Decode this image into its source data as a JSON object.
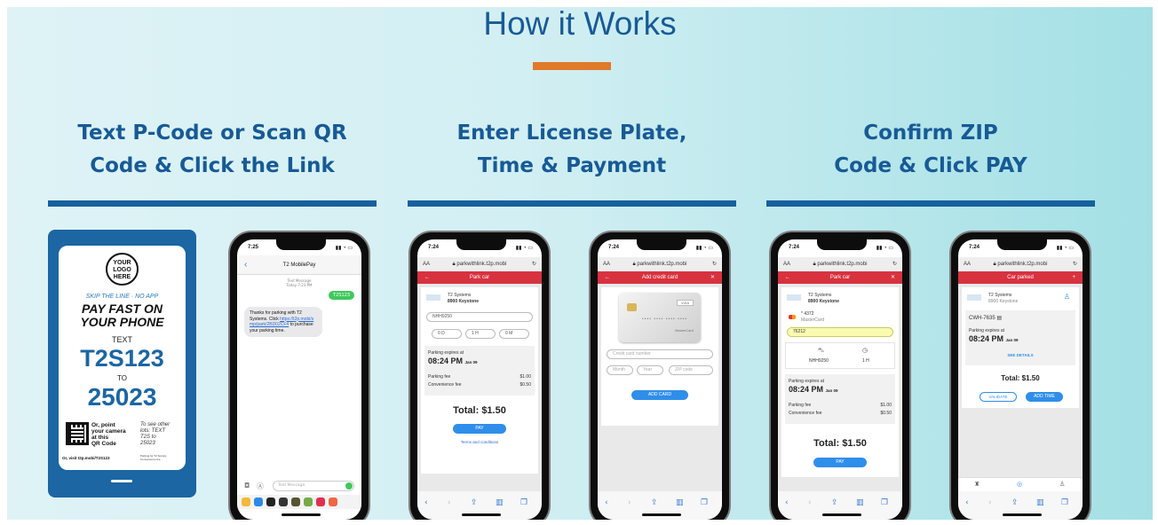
{
  "header": {
    "title": "How it Works"
  },
  "steps": [
    {
      "line1": "Text P-Code or Scan QR",
      "line2": "Code & Click the Link"
    },
    {
      "line1": "Enter License Plate,",
      "line2": "Time & Payment"
    },
    {
      "line1": "Confirm ZIP",
      "line2": "Code & Click PAY"
    }
  ],
  "signage": {
    "logo": "YOUR LOGO HERE",
    "tagline": "SKIP THE LINE · NO APP",
    "headline1": "PAY FAST ON",
    "headline2": "YOUR PHONE",
    "text_label": "TEXT",
    "code": "T2S123",
    "to_label": "TO",
    "number": "25023",
    "qr_text1": "Or, point",
    "qr_text2": "your camera",
    "qr_text3": "at this",
    "qr_text4": "QR Code",
    "right_text1": "To see other",
    "right_text2": "lots: TEXT",
    "right_text3": "T2S to",
    "right_text4": "25023",
    "footer": "Or, visit t2p.mobi/T2S123",
    "footer_fine": "Parking for T2 Society. Convenience fee"
  },
  "sms": {
    "time": "7:25",
    "contact": "T2 MobilePay",
    "meta1": "Text Message",
    "meta2": "Today 7:23 PM",
    "sent": "T2S123",
    "received": "Thanks for parking with T2 Systems. Click",
    "link": "https://t2p.mobi/smp/park/2BD02CF4",
    "received_end": "to purchase your parking time.",
    "input_placeholder": "Text Message"
  },
  "browser": {
    "aa": "AA",
    "url": "parkwithlink.t2p.mobi"
  },
  "park_screen": {
    "time": "7:24",
    "header": "Park car",
    "company": "T2 Systems",
    "lot": "8900 Keystone",
    "plate": "NHH9250",
    "sel_d": "0 D",
    "sel_h": "1 H",
    "sel_m": "0 M",
    "expires_label": "Parking expires at",
    "expires_time": "08:24 PM",
    "expires_date": "Jan 09",
    "fee_label": "Parking fee",
    "fee": "$1.00",
    "conv_label": "Convenience fee",
    "conv": "$0.50",
    "total": "Total: $1.50",
    "pay": "PAY",
    "terms": "Terms and conditions"
  },
  "credit_screen": {
    "time": "7:24",
    "header": "Add credit card",
    "card_number": "•••• •••• •••• ••••",
    "card_name": "MasterCard",
    "card_brand": "VISA",
    "ph_number": "Credit card number",
    "ph_month": "Month",
    "ph_year": "Year",
    "ph_zip": "ZIP code",
    "add_card": "ADD CARD"
  },
  "confirm_screen": {
    "time": "7:24",
    "header": "Park car",
    "company": "T2 Systems",
    "lot": "8900 Keystone",
    "card_last": "* 4372",
    "card_type": "MasterCard",
    "zip": "76212",
    "plate": "NHH9250",
    "duration": "1 H",
    "expires_label": "Parking expires at",
    "expires_time": "08:24 PM",
    "expires_date": "Jan 09",
    "fee_label": "Parking fee",
    "fee": "$1.00",
    "conv_label": "Convenience fee",
    "conv": "$0.50",
    "total": "Total: $1.50",
    "pay": "PAY"
  },
  "parked_screen": {
    "time": "7:24",
    "header": "Car parked",
    "company": "T2 Systems",
    "lot": "8900 Keystone",
    "plate": "CWH-7635",
    "expires_label": "Parking expires at",
    "expires_time": "08:24 PM",
    "expires_date": "Jan 09",
    "see_details": "SEE DETAILS",
    "total": "Total: $1.50",
    "validate": "VALIDATE",
    "add_time": "ADD TIME"
  },
  "colors": {
    "brand": "#175a96",
    "accent": "#e17a2a",
    "red": "#d8323f",
    "button": "#2f8eea"
  }
}
